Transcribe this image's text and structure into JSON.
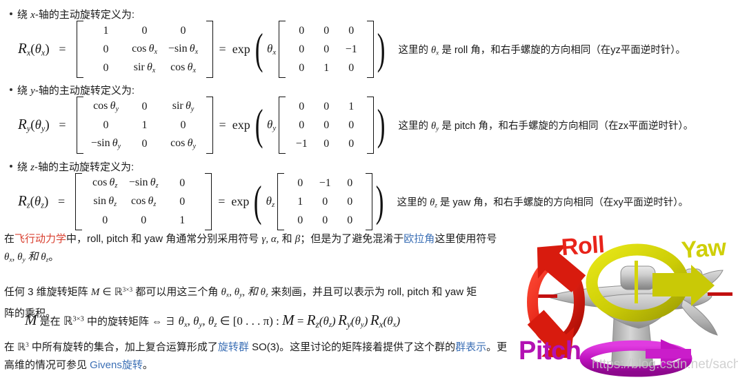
{
  "bullets": [
    {
      "prefix": "绕 ",
      "axis": "x",
      "suffix": "-轴的主动旋转定义为:"
    },
    {
      "prefix": "绕 ",
      "axis": "y",
      "suffix": "-轴的主动旋转定义为:"
    },
    {
      "prefix": "绕 ",
      "axis": "z",
      "suffix": "-轴的主动旋转定义为:"
    }
  ],
  "equations": [
    {
      "id": "rx",
      "lhs": "R",
      "lhs_sub": "x",
      "arg_sub": "x",
      "matrix": [
        [
          "1",
          "0",
          "0"
        ],
        [
          "0",
          "cos θ",
          "− sin θ"
        ],
        [
          "0",
          "sir θ",
          "cos θ"
        ]
      ],
      "matrix_cells": [
        [
          "1",
          "0",
          "0"
        ],
        [
          "0",
          "cos",
          "−sin"
        ],
        [
          "0",
          "sir",
          "cos"
        ]
      ],
      "equals": "=",
      "exp": "exp",
      "theta": "θ",
      "theta_sub": "x",
      "expmatrix": [
        [
          "0",
          "0",
          "0"
        ],
        [
          "0",
          "0",
          "−1"
        ],
        [
          "0",
          "1",
          "0"
        ]
      ],
      "note": "这里的 θ𝑥 是 roll 角，和右手螺旋的方向相同（在yz平面逆时针）。",
      "note_pre": "这里的 ",
      "note_theta": "θ",
      "note_theta_sub": "x",
      "note_post": " 是 roll 角，和右手螺旋的方向相同（在yz平面逆时针）。"
    },
    {
      "id": "ry",
      "lhs": "R",
      "lhs_sub": "y",
      "arg_sub": "y",
      "matrix_cells": [
        [
          "cos",
          "0",
          "sir"
        ],
        [
          "0",
          "1",
          "0"
        ],
        [
          "−sin",
          "0",
          "cos"
        ]
      ],
      "equals": "=",
      "exp": "exp",
      "theta": "θ",
      "theta_sub": "y",
      "expmatrix": [
        [
          "0",
          "0",
          "1"
        ],
        [
          "0",
          "0",
          "0"
        ],
        [
          "−1",
          "0",
          "0"
        ]
      ],
      "note_pre": "这里的 ",
      "note_theta": "θ",
      "note_theta_sub": "y",
      "note_post": " 是 pitch 角，和右手螺旋的方向相同（在zx平面逆时针）。"
    },
    {
      "id": "rz",
      "lhs": "R",
      "lhs_sub": "z",
      "arg_sub": "z",
      "matrix_cells": [
        [
          "cos",
          "−sin",
          "0"
        ],
        [
          "sin",
          "cos",
          "0"
        ],
        [
          "0",
          "0",
          "1"
        ]
      ],
      "equals": "=",
      "exp": "exp",
      "theta": "θ",
      "theta_sub": "z",
      "expmatrix": [
        [
          "0",
          "−1",
          "0"
        ],
        [
          "1",
          "0",
          "0"
        ],
        [
          "0",
          "0",
          "0"
        ]
      ],
      "note_pre": "这里的 ",
      "note_theta": "θ",
      "note_theta_sub": "z",
      "note_post": " 是 yaw 角，和右手螺旋的方向相同（在xy平面逆时针）。"
    }
  ],
  "paragraphs": {
    "p1_a": "在",
    "p1_link1": "飞行动力学",
    "p1_b": "中，roll, pitch 和 yaw 角通常分别采用符号 ",
    "p1_sym1": "γ, α,",
    "p1_c": " 和 ",
    "p1_sym2": "β",
    "p1_d": "；但是为了避免混淆于",
    "p1_link2": "欧拉角",
    "p1_e": "这里使用符号",
    "p1_line2_a": "θ",
    "p1_line2_sub1": "x",
    "p1_line2_b": ", θ",
    "p1_line2_sub2": "y",
    "p1_line2_c": " 和 θ",
    "p1_line2_sub3": "z",
    "p1_line2_d": "。",
    "p2_a": "任何 3 维旋转矩阵 ",
    "p2_M": "M",
    "p2_in": " ∈ ",
    "p2_R": "ℝ",
    "p2_Rsup": "3×3",
    "p2_b": " 都可以用这三个角 ",
    "p2_t1": "θ",
    "p2_t1s": "x",
    "p2_t2": ", θ",
    "p2_t2s": "y",
    "p2_t3": ", 和 θ",
    "p2_t3s": "z",
    "p2_c": " 来刻画，并且可以表示为 roll, pitch 和 yaw 矩",
    "p2_line2": "阵的乘积。",
    "p3_a": "M",
    "p3_b": " 是在 ",
    "p3_R": "ℝ",
    "p3_Rsup": "3×3",
    "p3_c": " 中的旋转矩阵 ⇔ ∃ ",
    "p3_d": "θ",
    "p3_ds": "x",
    "p3_e": ", θ",
    "p3_es": "y",
    "p3_f": ", θ",
    "p3_fs": "z",
    "p3_g": " ∈ [0 . . . π) : ",
    "p3_h": "M",
    "p3_i": " = ",
    "p3_r1": "R",
    "p3_r1s": "z",
    "p3_a1": "(θ",
    "p3_a1s": "z",
    "p3_a1e": ")",
    "p3_r2": "R",
    "p3_r2s": "y",
    "p3_a2": "(θ",
    "p3_a2s": "y",
    "p3_a2e": ")",
    "p3_r3": "R",
    "p3_r3s": "x",
    "p3_a3": "(θ",
    "p3_a3s": "x",
    "p3_a3e": ")",
    "p4_a": "在 ",
    "p4_R": "ℝ",
    "p4_Rsup": "3",
    "p4_b": " 中所有旋转的集合，加上复合运算形成了",
    "p4_link1": "旋转群",
    "p4_c": " SO(3)。这里讨论的矩阵接着提供了这个群的",
    "p4_link2": "群表示",
    "p4_d": "。更",
    "p4_line2_a": "高维的情况可参见 ",
    "p4_link3": "Givens旋转",
    "p4_line2_b": "。"
  },
  "illustration": {
    "labels": {
      "roll": "Roll",
      "yaw": "Yaw",
      "pitch": "Pitch"
    },
    "colors": {
      "roll": "#e8231a",
      "yaw": "#cfcf08",
      "pitch": "#b311b3",
      "plane": "#b9b9b9"
    },
    "watermark": "https://blog.csdn.net/sachin_woo"
  }
}
